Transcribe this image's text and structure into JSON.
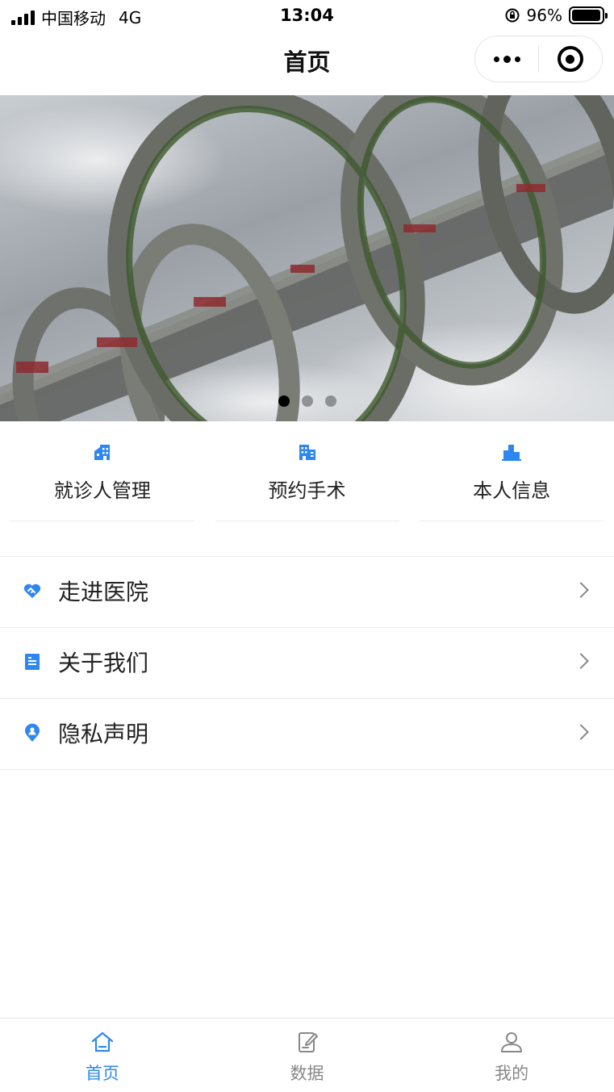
{
  "status_bar": {
    "carrier": "中国移动",
    "network": "4G",
    "time": "13:04",
    "battery_percent": "96%",
    "battery_level": 0.96
  },
  "nav": {
    "title": "首页"
  },
  "banner": {
    "slide_count": 3,
    "active_index": 0
  },
  "quick_grid": [
    {
      "label": "就诊人管理",
      "icon": "building-house-icon"
    },
    {
      "label": "预约手术",
      "icon": "office-building-icon"
    },
    {
      "label": "本人信息",
      "icon": "city-buildings-icon"
    }
  ],
  "menu": [
    {
      "label": "走进医院",
      "icon": "heart-handshake-icon"
    },
    {
      "label": "关于我们",
      "icon": "document-icon"
    },
    {
      "label": "隐私声明",
      "icon": "location-user-icon"
    }
  ],
  "tabs": [
    {
      "label": "首页",
      "icon": "home-icon",
      "active": true
    },
    {
      "label": "数据",
      "icon": "edit-document-icon",
      "active": false
    },
    {
      "label": "我的",
      "icon": "user-icon",
      "active": false
    }
  ],
  "colors": {
    "accent": "#2e87f0",
    "text": "#222222",
    "muted": "#888888"
  }
}
